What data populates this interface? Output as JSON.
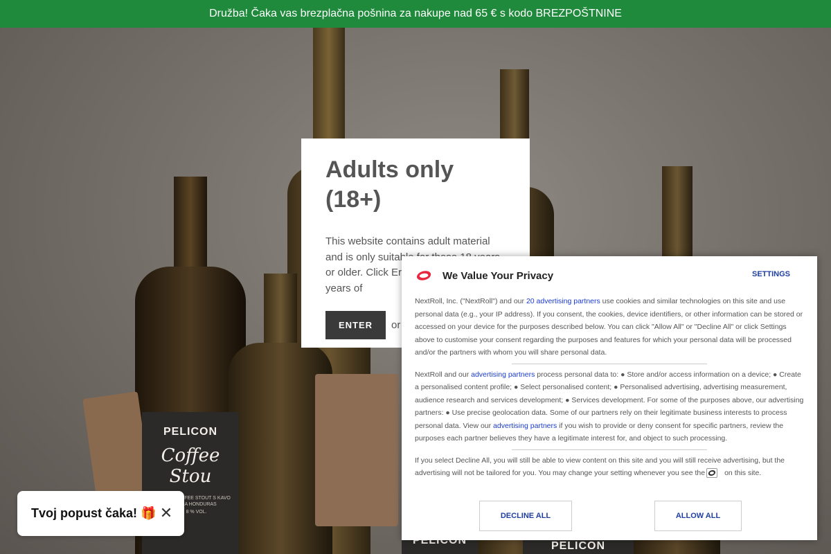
{
  "promo_bar": {
    "text": "Družba! Čaka vas brezplačna pošnina za nakupe nad 65 € s kodo BREZPOŠTNINE"
  },
  "hero": {
    "labels": [
      {
        "brand": "PELICON",
        "name": "Coffee Stou",
        "small": "IMPERIAL COFFEE STOUT S KAVO MARCALA HONDURAS",
        "abv": "ALK. 8 % VOL."
      },
      {
        "brand": "PELICON"
      },
      {
        "brand": "PELICON"
      }
    ]
  },
  "age_gate": {
    "title": "Adults only (18+)",
    "text": "This website contains adult material and is only suitable for those 18 years or older. Click Er                    least 18 years of",
    "enter_label": "ENTER",
    "or_text": "or"
  },
  "privacy": {
    "title": "We Value Your Privacy",
    "settings_label": "SETTINGS",
    "p1_before": "NextRoll, Inc. (\"NextRoll\") and our ",
    "p1_link": "20 advertising partners",
    "p1_after": " use cookies and similar technologies on this site and use personal data (e.g., your IP address). If you consent, the cookies, device identifiers, or other information can be stored or accessed on your device for the purposes described below. You can click \"Allow All\" or \"Decline All\" or click Settings above to customise your consent regarding the purposes and features for which your personal data will be processed and/or the partners with whom you will share personal data.",
    "p2_before": "NextRoll and our ",
    "p2_link1": "advertising partners",
    "p2_middle": " process personal data to: ● Store and/or access information on a device; ● Create a personalised content profile; ● Select personalised content; ● Personalised advertising, advertising measurement, audience research and services development; ● Services development. For some of the purposes above, our advertising partners: ● Use precise geolocation data. Some of our partners rely on their legitimate business interests to process personal data. View our ",
    "p2_link2": "advertising partners",
    "p2_after": " if you wish to provide or deny consent for specific partners, review the purposes each partner believes they have a legitimate interest for, and object to such processing.",
    "p3_before": "If you select Decline All, you will still be able to view content on this site and you will still receive advertising, but the advertising will not be tailored for you. You may change your setting whenever you see the",
    "p3_after": "on this site.",
    "decline_label": "DECLINE ALL",
    "allow_label": "ALLOW ALL",
    "logo_icon": "nextroll-logo-icon",
    "accent": "#e8263e"
  },
  "discount": {
    "text": "Tvoj popust čaka! 🎁",
    "close_label": "✕"
  }
}
